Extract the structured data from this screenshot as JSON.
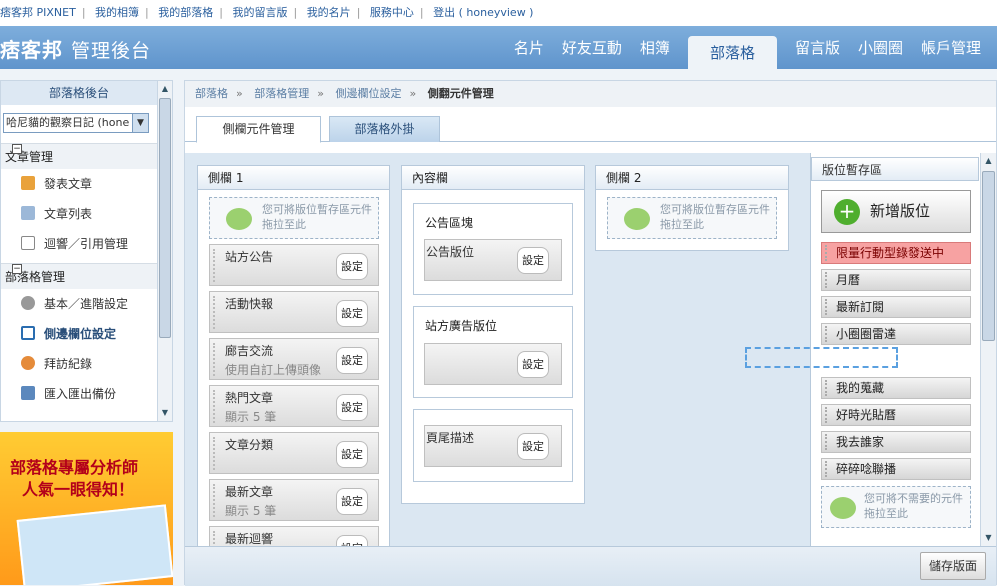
{
  "topbar": {
    "links": [
      "痞客邦 PIXNET",
      "我的相簿",
      "我的部落格",
      "我的留言版",
      "我的名片",
      "服務中心",
      "登出 ( honeyview )"
    ],
    "separator": "|"
  },
  "header": {
    "logo": "痞客邦",
    "subtitle": "管理後台",
    "nav": [
      "名片",
      "好友互動",
      "相簿",
      "部落格",
      "留言版",
      "小圈圈",
      "帳戶管理"
    ],
    "active_index": 3
  },
  "sidebar": {
    "title": "部落格後台",
    "blog_select": "哈尼貓的觀察日記 (hone",
    "sections": [
      {
        "title": "文章管理",
        "toggle": "−",
        "items": [
          {
            "label": "發表文章",
            "icon": "pencil-icon"
          },
          {
            "label": "文章列表",
            "icon": "pages-icon"
          },
          {
            "label": "迴響／引用管理",
            "icon": "comment-icon"
          }
        ]
      },
      {
        "title": "部落格管理",
        "toggle": "−",
        "items": [
          {
            "label": "基本／進階設定",
            "icon": "gear-icon"
          },
          {
            "label": "側邊欄位設定",
            "icon": "layout-icon",
            "active": true
          },
          {
            "label": "拜訪紀錄",
            "icon": "visitors-icon"
          },
          {
            "label": "匯入匯出備份",
            "icon": "backup-icon"
          }
        ]
      }
    ],
    "ad": {
      "line1": "部落格專屬分析師",
      "line2": "人氣一眼得知！"
    }
  },
  "breadcrumb": {
    "items": [
      "部落格",
      "部落格管理",
      "側邊欄位設定"
    ],
    "current": "側翻元件管理",
    "separator": "»"
  },
  "tabs": {
    "active": "側欄元件管理",
    "other": "部落格外掛"
  },
  "columns": {
    "sidebar1": {
      "title": "側欄 1",
      "drop_hint": "您可將版位暫存區元件拖拉至此",
      "widgets": [
        {
          "name": "站方公告",
          "sub": ""
        },
        {
          "name": "活動快報",
          "sub": ""
        },
        {
          "name": "廊吉交流",
          "sub": "使用自訂上傳頭像"
        },
        {
          "name": "熱門文章",
          "sub": "顯示 5 筆"
        },
        {
          "name": "文章分類",
          "sub": ""
        },
        {
          "name": "最新文章",
          "sub": "顯示 5 筆"
        },
        {
          "name": "最新迴響",
          "sub": ""
        }
      ]
    },
    "content": {
      "title": "內容欄",
      "boxes": [
        {
          "title": "公告區塊",
          "inner": "公告版位"
        },
        {
          "title": "站方廣告版位",
          "inner": ""
        },
        {
          "title": "",
          "inner": "頁尾描述"
        }
      ]
    },
    "sidebar2": {
      "title": "側欄 2",
      "drop_hint": "您可將版位暫存區元件拖拉至此"
    }
  },
  "set_label": "設定",
  "pool": {
    "title": "版位暫存區",
    "add_button": "新增版位",
    "items": [
      {
        "name": "限量行動型錄發送中",
        "highlight": true
      },
      {
        "name": "月曆"
      },
      {
        "name": "最新訂閱"
      },
      {
        "name": "小圈圈雷達"
      },
      {
        "name": "我的蒐藏"
      },
      {
        "name": "好時光貼曆"
      },
      {
        "name": "我去誰家"
      },
      {
        "name": "碎碎唸聯播"
      }
    ],
    "trash_hint": "您可將不需要的元件拖拉至此"
  },
  "footer": {
    "save": "儲存版面"
  },
  "colors": {
    "accent": "#5f94cc",
    "highlight": "#f7a2a2",
    "canvas": "#dbe7f2"
  }
}
